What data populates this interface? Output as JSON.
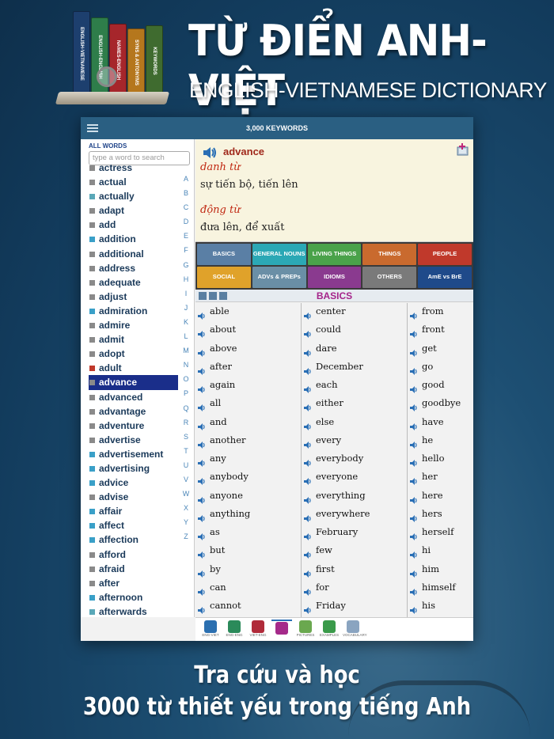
{
  "header": {
    "title_vi": "TỪ ĐIỂN ANH-VIỆT",
    "title_en": "ENGLISH-VIETNAMESE DICTIONARY",
    "books": [
      {
        "label": "ENGLISH-VIETNAMESE",
        "color": "#1d3f6e"
      },
      {
        "label": "ENGLISH-ENGLISH",
        "color": "#2e7d4a"
      },
      {
        "label": "NAMES-ENGLISH",
        "color": "#a6262b"
      },
      {
        "label": "SYNS & ANTONYMS",
        "color": "#b5771d"
      },
      {
        "label": "KEYWORDS",
        "color": "#3f6b2f"
      }
    ]
  },
  "app": {
    "topbar_title": "3,000 KEYWORDS",
    "all_words_label": "ALL WORDS",
    "search_placeholder": "type a word to search",
    "word_list": [
      {
        "word": "actress",
        "color": "#8a8a8a"
      },
      {
        "word": "actual",
        "color": "#8a8a8a"
      },
      {
        "word": "actually",
        "color": "#5aa8b8"
      },
      {
        "word": "adapt",
        "color": "#8a8a8a"
      },
      {
        "word": "add",
        "color": "#8a8a8a"
      },
      {
        "word": "addition",
        "color": "#3aa0c8"
      },
      {
        "word": "additional",
        "color": "#8a8a8a"
      },
      {
        "word": "address",
        "color": "#8a8a8a"
      },
      {
        "word": "adequate",
        "color": "#8a8a8a"
      },
      {
        "word": "adjust",
        "color": "#8a8a8a"
      },
      {
        "word": "admiration",
        "color": "#3aa0c8"
      },
      {
        "word": "admire",
        "color": "#8a8a8a"
      },
      {
        "word": "admit",
        "color": "#8a8a8a"
      },
      {
        "word": "adopt",
        "color": "#8a8a8a"
      },
      {
        "word": "adult",
        "color": "#c0392b"
      },
      {
        "word": "advance",
        "color": "#8a8a8a",
        "selected": true
      },
      {
        "word": "advanced",
        "color": "#8a8a8a"
      },
      {
        "word": "advantage",
        "color": "#8a8a8a"
      },
      {
        "word": "adventure",
        "color": "#8a8a8a"
      },
      {
        "word": "advertise",
        "color": "#8a8a8a"
      },
      {
        "word": "advertisement",
        "color": "#3aa0c8"
      },
      {
        "word": "advertising",
        "color": "#3aa0c8"
      },
      {
        "word": "advice",
        "color": "#3aa0c8"
      },
      {
        "word": "advise",
        "color": "#8a8a8a"
      },
      {
        "word": "affair",
        "color": "#3aa0c8"
      },
      {
        "word": "affect",
        "color": "#3aa0c8"
      },
      {
        "word": "affection",
        "color": "#3aa0c8"
      },
      {
        "word": "afford",
        "color": "#8a8a8a"
      },
      {
        "word": "afraid",
        "color": "#8a8a8a"
      },
      {
        "word": "after",
        "color": "#8a8a8a"
      },
      {
        "word": "afternoon",
        "color": "#3aa0c8"
      },
      {
        "word": "afterwards",
        "color": "#5aa8b8"
      }
    ],
    "alphabet": [
      "A",
      "B",
      "C",
      "D",
      "E",
      "F",
      "G",
      "H",
      "I",
      "J",
      "K",
      "L",
      "M",
      "N",
      "O",
      "P",
      "Q",
      "R",
      "S",
      "T",
      "U",
      "V",
      "W",
      "X",
      "Y",
      "Z"
    ],
    "definition": {
      "headword": "advance",
      "senses": [
        {
          "pos": "danh từ",
          "meaning": "sự tiến bộ, tiến lên"
        },
        {
          "pos": "động từ",
          "meaning": "đưa lên, để xuất"
        }
      ]
    },
    "categories": [
      {
        "label": "BASICS",
        "color": "#5a7fa5"
      },
      {
        "label": "GENERAL NOUNS",
        "color": "#2ba8b5"
      },
      {
        "label": "LIVING THINGS",
        "color": "#4aa24a"
      },
      {
        "label": "THINGS",
        "color": "#c96a2e"
      },
      {
        "label": "PEOPLE",
        "color": "#c0392b"
      },
      {
        "label": "SOCIAL",
        "color": "#e0a22a"
      },
      {
        "label": "ADVs & PREPs",
        "color": "#6a8fa6"
      },
      {
        "label": "IDIOMS",
        "color": "#8a3a8f"
      },
      {
        "label": "OTHERS",
        "color": "#7a7a7a"
      },
      {
        "label": "AmE vs BrE",
        "color": "#1f4a8a"
      }
    ],
    "section_title": "BASICS",
    "columns": [
      [
        "able",
        "about",
        "above",
        "after",
        "again",
        "all",
        "and",
        "another",
        "any",
        "anybody",
        "anyone",
        "anything",
        "as",
        "but",
        "by",
        "can",
        "cannot"
      ],
      [
        "center",
        "could",
        "dare",
        "December",
        "each",
        "either",
        "else",
        "every",
        "everybody",
        "everyone",
        "everything",
        "everywhere",
        "February",
        "few",
        "first",
        "for",
        "Friday"
      ],
      [
        "from",
        "front",
        "get",
        "go",
        "good",
        "goodbye",
        "have",
        "he",
        "hello",
        "her",
        "here",
        "hers",
        "herself",
        "hi",
        "him",
        "himself",
        "his"
      ]
    ],
    "bottom_tabs": [
      {
        "label": "ENG-VIET",
        "color": "#2b6fb0"
      },
      {
        "label": "ENG-ENG",
        "color": "#2b8a5a"
      },
      {
        "label": "VIET-ENG",
        "color": "#b02b3a"
      },
      {
        "label": "",
        "color": "#a52a8a",
        "active": true
      },
      {
        "label": "PICTURES",
        "color": "#6aa84f"
      },
      {
        "label": "EXAMPLES",
        "color": "#3a9a4a"
      },
      {
        "label": "VOCABULARY",
        "color": "#8aa4c0"
      }
    ]
  },
  "tagline": {
    "line1": "Tra cứu và học",
    "line2": "3000 từ thiết yếu trong tiếng Anh"
  }
}
